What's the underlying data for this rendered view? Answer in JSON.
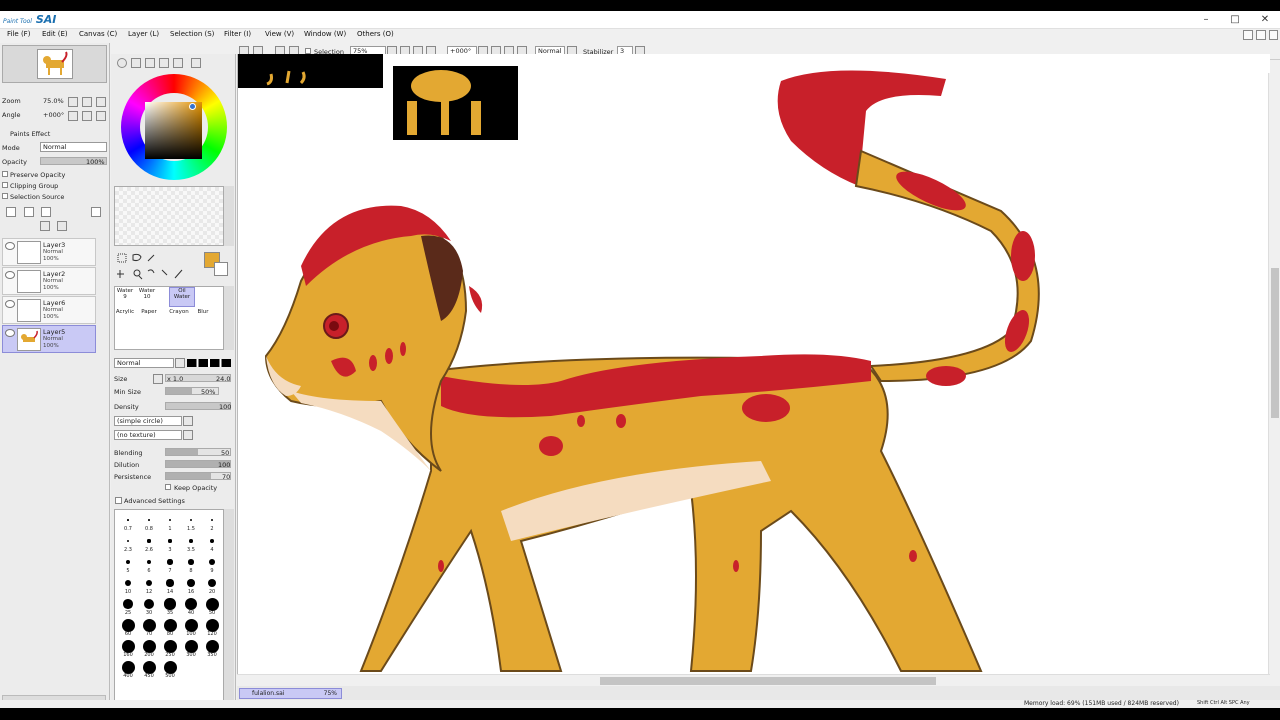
{
  "app": {
    "title": "SAI",
    "logo_prefix": "Paint Tool"
  },
  "window_controls": {
    "minimize": "–",
    "maximize": "□",
    "close": "✕"
  },
  "menu": [
    "File (F)",
    "Edit (E)",
    "Canvas (C)",
    "Layer (L)",
    "Selection (S)",
    "Filter (I)",
    "View (V)",
    "Window (W)",
    "Others (O)"
  ],
  "navigator": {
    "zoom_label": "Zoom",
    "zoom_value": "75.0%",
    "angle_label": "Angle",
    "angle_value": "+000°"
  },
  "layer_props": {
    "paints_effect": "Paints Effect",
    "mode_label": "Mode",
    "mode_value": "Normal",
    "opacity_label": "Opacity",
    "opacity_value": "100%",
    "preserve_opacity": "Preserve Opacity",
    "clipping_group": "Clipping Group",
    "selection_source": "Selection Source"
  },
  "layers": [
    {
      "name": "Layer3",
      "mode": "Normal",
      "opacity": "100%",
      "active": false
    },
    {
      "name": "Layer2",
      "mode": "Normal",
      "opacity": "100%",
      "active": false
    },
    {
      "name": "Layer6",
      "mode": "Normal",
      "opacity": "100%",
      "active": false
    },
    {
      "name": "Layer5",
      "mode": "Normal",
      "opacity": "100%",
      "active": true
    }
  ],
  "canvas_toolbar": {
    "selection_label": "Selection",
    "zoom": "75%",
    "angle": "+000°",
    "mode": "Normal",
    "stabilizer_label": "Stabilizer",
    "stabilizer_value": "3"
  },
  "color": {
    "primary": "#e3a832",
    "secondary": "#ffffff"
  },
  "brush_tools": [
    {
      "name": "Water",
      "size": "9"
    },
    {
      "name": "Water",
      "size": "10"
    },
    {
      "name": "Oil Water",
      "size": ""
    },
    {
      "name": "Acrylic",
      "size": ""
    },
    {
      "name": "Paper",
      "size": ""
    },
    {
      "name": "Crayon",
      "size": ""
    },
    {
      "name": "Blur",
      "size": ""
    }
  ],
  "brush_settings": {
    "blend_mode": "Normal",
    "size_label": "Size",
    "size_mult": "x 1.0",
    "size_value": "24.0",
    "min_size_label": "Min Size",
    "min_size_value": "50%",
    "min_size_pct": 50,
    "density_label": "Density",
    "density_value": "100",
    "shape": "(simple circle)",
    "texture": "(no texture)",
    "blending_label": "Blending",
    "blending_value": "50",
    "blending_pct": 50,
    "dilution_label": "Dilution",
    "dilution_value": "100",
    "dilution_pct": 100,
    "persistence_label": "Persistence",
    "persistence_value": "70",
    "persistence_pct": 70,
    "keep_opacity": "Keep Opacity",
    "advanced": "Advanced Settings"
  },
  "brush_sizes": [
    "0.7",
    "0.8",
    "1",
    "1.5",
    "2",
    "2.3",
    "2.6",
    "3",
    "3.5",
    "4",
    "5",
    "6",
    "7",
    "8",
    "9",
    "10",
    "12",
    "14",
    "16",
    "20",
    "25",
    "30",
    "35",
    "40",
    "50",
    "60",
    "70",
    "80",
    "100",
    "120",
    "160",
    "200",
    "250",
    "300",
    "350",
    "400",
    "450",
    "500"
  ],
  "document_tab": {
    "name": "fulalion.sai",
    "zoom": "75%"
  },
  "status": {
    "memory": "Memory load: 69% (151MB used / 824MB reserved)",
    "keys": "Shift Ctrl Alt SPC Any"
  }
}
